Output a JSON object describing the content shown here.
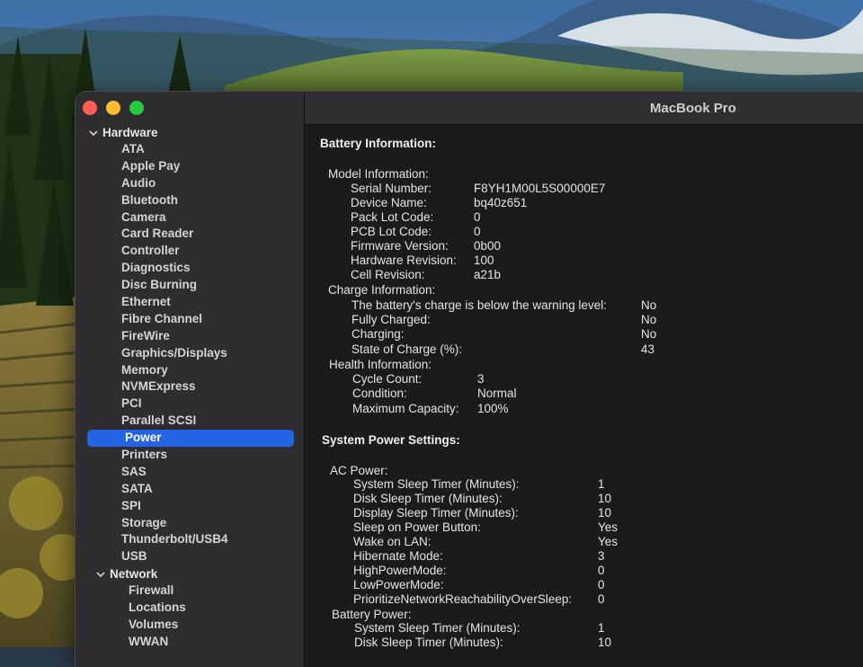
{
  "window": {
    "title": "MacBook Pro"
  },
  "sidebar": {
    "hardware_label": "Hardware",
    "hardware_items": [
      "ATA",
      "Apple Pay",
      "Audio",
      "Bluetooth",
      "Camera",
      "Card Reader",
      "Controller",
      "Diagnostics",
      "Disc Burning",
      "Ethernet",
      "Fibre Channel",
      "FireWire",
      "Graphics/Displays",
      "Memory",
      "NVMExpress",
      "PCI",
      "Parallel SCSI",
      "Power",
      "Printers",
      "SAS",
      "SATA",
      "SPI",
      "Storage",
      "Thunderbolt/USB4",
      "USB"
    ],
    "selected_item": "Power",
    "network_label": "Network",
    "network_items": [
      "Firewall",
      "Locations",
      "Volumes",
      "WWAN"
    ]
  },
  "battery": {
    "title": "Battery Information:",
    "model_label": "Model Information:",
    "model": [
      {
        "label": "Serial Number:",
        "value": "F8YH1M00L5S00000E7"
      },
      {
        "label": "Device Name:",
        "value": "bq40z651"
      },
      {
        "label": "Pack Lot Code:",
        "value": "0"
      },
      {
        "label": "PCB Lot Code:",
        "value": "0"
      },
      {
        "label": "Firmware Version:",
        "value": "0b00"
      },
      {
        "label": "Hardware Revision:",
        "value": "100"
      },
      {
        "label": "Cell Revision:",
        "value": "a21b"
      }
    ],
    "charge_label": "Charge Information:",
    "charge": [
      {
        "label": "The battery's charge is below the warning level:",
        "value": "No"
      },
      {
        "label": "Fully Charged:",
        "value": "No"
      },
      {
        "label": "Charging:",
        "value": "No"
      },
      {
        "label": "State of Charge (%):",
        "value": "43"
      }
    ],
    "health_label": "Health Information:",
    "health": [
      {
        "label": "Cycle Count:",
        "value": "3"
      },
      {
        "label": "Condition:",
        "value": "Normal"
      },
      {
        "label": "Maximum Capacity:",
        "value": "100%"
      }
    ]
  },
  "power": {
    "title": "System Power Settings:",
    "ac_label": "AC Power:",
    "ac": [
      {
        "label": "System Sleep Timer (Minutes):",
        "value": "1"
      },
      {
        "label": "Disk Sleep Timer (Minutes):",
        "value": "10"
      },
      {
        "label": "Display Sleep Timer (Minutes):",
        "value": "10"
      },
      {
        "label": "Sleep on Power Button:",
        "value": "Yes"
      },
      {
        "label": "Wake on LAN:",
        "value": "Yes"
      },
      {
        "label": "Hibernate Mode:",
        "value": "3"
      },
      {
        "label": "HighPowerMode:",
        "value": "0"
      },
      {
        "label": "LowPowerMode:",
        "value": "0"
      },
      {
        "label": "PrioritizeNetworkReachabilityOverSleep:",
        "value": "0"
      }
    ],
    "battery_label": "Battery Power:",
    "battery": [
      {
        "label": "System Sleep Timer (Minutes):",
        "value": "1"
      },
      {
        "label": "Disk Sleep Timer (Minutes):",
        "value": "10"
      }
    ]
  }
}
